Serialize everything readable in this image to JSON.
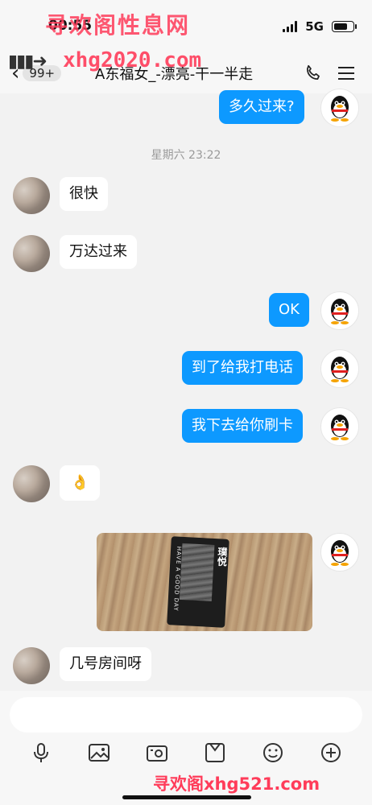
{
  "status_bar": {
    "time": "00:55",
    "network": "5G"
  },
  "watermarks": {
    "top": "寻欢阁性息网",
    "middle": "xhg2020.com",
    "bottom": "寻欢阁xhg521.com"
  },
  "nav": {
    "unread_count": "99+",
    "title": "A东福女_-漂亮-干一半走"
  },
  "messages": [
    {
      "side": "out",
      "text": "多久过来?"
    },
    {
      "side": "in",
      "text": "很快"
    },
    {
      "side": "in",
      "text": "万达过来"
    },
    {
      "side": "out",
      "text": "OK"
    },
    {
      "side": "out",
      "text": "到了给我打电话"
    },
    {
      "side": "out",
      "text": "我下去给你刷卡"
    },
    {
      "side": "in",
      "text": "👌"
    },
    {
      "side": "out",
      "type": "image",
      "card_text": "HAVE A GOOD DAY",
      "card_cn": "璞悦"
    },
    {
      "side": "in",
      "text": "几号房间呀"
    }
  ],
  "time_divider": "星期六 23:22",
  "input": {
    "placeholder": ""
  },
  "toolbar": [
    "microphone-icon",
    "image-icon",
    "camera-icon",
    "file-icon",
    "emoji-icon",
    "plus-icon"
  ],
  "colors": {
    "out_bubble": "#0d99ff",
    "in_bubble": "#ffffff",
    "background": "#f2f2f2"
  }
}
